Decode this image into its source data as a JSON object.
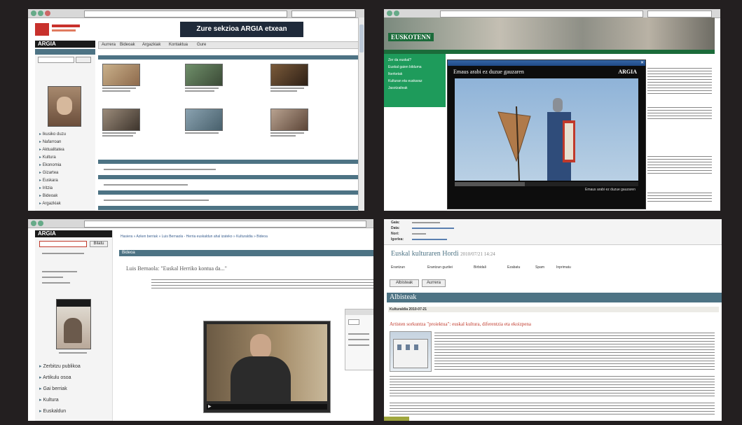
{
  "panel1": {
    "ad_banner": "Zure sekzioa ARGIA etxean",
    "brand_logo": "ARGIA",
    "nav_tabs": [
      "Aurrera",
      "Bideoak",
      "Argazkiak",
      "Kontaktua",
      "Gure"
    ],
    "sidebar_items": [
      "Ikusiko duzu",
      "Nafarroan",
      "Aktualitatea",
      "Kultura",
      "Ekonomia",
      "Gizartea",
      "Euskara",
      "Iritzia",
      "Bideoak",
      "Argazkiak"
    ],
    "colors": {
      "logo_red": "#c8312c",
      "bar": "#4d7384"
    }
  },
  "panel2": {
    "site_logo": "EUSKOTENN",
    "video_title": "Emaus arabi ez duzue gauzaren",
    "video_brand": "ARGIA",
    "side_menu": [
      "Zer da euskal?",
      "Euskal gaien bilduma",
      "Ikerketak",
      "Kulturan eta euskaraz",
      "Jasotzaileak"
    ],
    "video_caption": "Emaus arabi ez duzue gauzaren"
  },
  "panel3": {
    "brand_logo": "ARGIA",
    "breadcrumb": "Hasiera » Azken berriak » Luis Bernaola - Herria euskaldun ahal izateko » Kulturaldia » Bideoa",
    "section_title": "Bideoa",
    "heading": "Luis Bernaola: \"Euskal Herriko kontua da...\"",
    "sidebar_items": [
      "Zerbitzu publikoa",
      "Artikulu osoa",
      "Gai berriak",
      "Kultura",
      "Euskaldun"
    ],
    "search_button": "Bilatu",
    "colors": {
      "bar": "#4d7384"
    }
  },
  "panel4": {
    "headers": [
      "Gaia:",
      "Data:",
      "Nori:",
      "Igorlea:"
    ],
    "title": "Euskal kulturaren Hordi",
    "date": "2010/07/21 14:24",
    "toolbar": [
      "Erantzun",
      "Erantzun guztiei",
      "Birbidali",
      "Ezabatu",
      "Spam",
      "Inprimatu"
    ],
    "buttons": [
      "Albisteak",
      "Aurrera"
    ],
    "section_title": "Albisteak",
    "article_label": "Kulturaldia 2010-07-21",
    "article_title": "Artisten sorkuntza \"proiektua\": euskal kultura, diferentzia eta ekoizpena",
    "colors": {
      "bar": "#4d7384",
      "link": "#c0392b"
    }
  }
}
